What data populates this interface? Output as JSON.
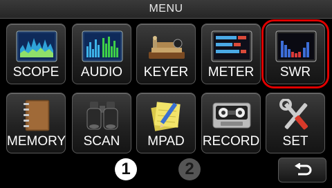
{
  "header": {
    "title": "MENU"
  },
  "menu": {
    "row1": [
      {
        "label": "SCOPE",
        "icon": "scope-icon"
      },
      {
        "label": "AUDIO",
        "icon": "audio-icon"
      },
      {
        "label": "KEYER",
        "icon": "keyer-icon"
      },
      {
        "label": "METER",
        "icon": "meter-icon"
      },
      {
        "label": "SWR",
        "icon": "swr-icon"
      }
    ],
    "row2": [
      {
        "label": "MEMORY",
        "icon": "memory-icon"
      },
      {
        "label": "SCAN",
        "icon": "binoculars-icon"
      },
      {
        "label": "MPAD",
        "icon": "notepad-icon"
      },
      {
        "label": "RECORD",
        "icon": "tape-recorder-icon"
      },
      {
        "label": "SET",
        "icon": "tools-icon"
      }
    ]
  },
  "pager": {
    "pages": [
      "1",
      "2"
    ],
    "current": "1"
  },
  "footer": {
    "back_icon": "return-arrow-icon"
  },
  "colors": {
    "highlight": "#e00000",
    "background": "#000000"
  }
}
